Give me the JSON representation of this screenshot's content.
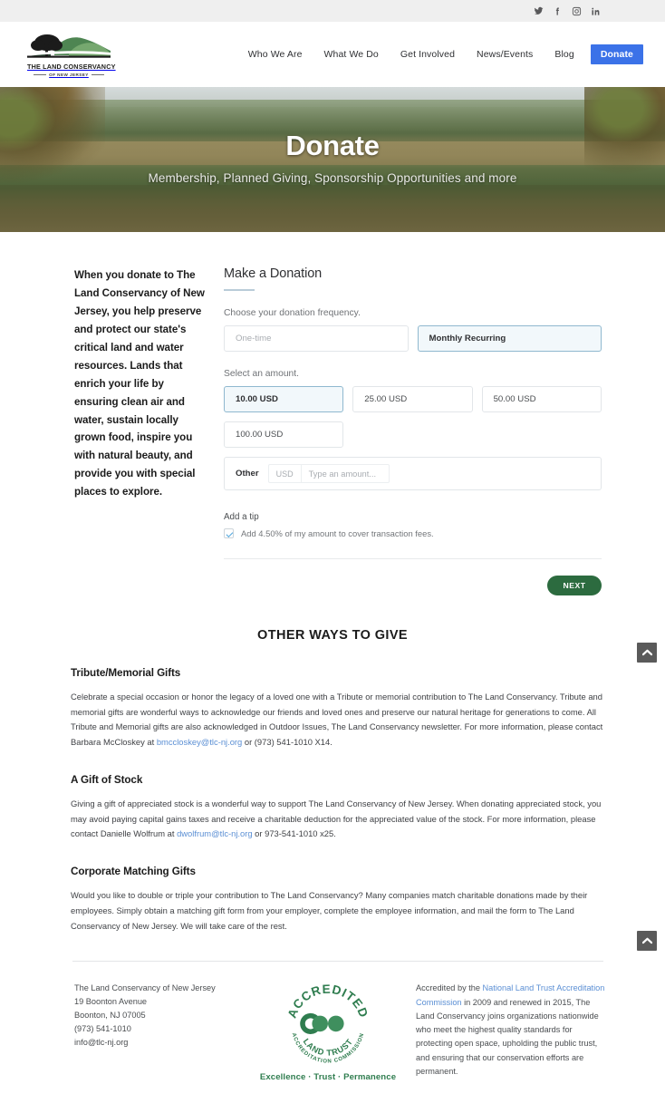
{
  "topbar": {
    "social": [
      {
        "name": "twitter-icon",
        "label": "Twitter"
      },
      {
        "name": "facebook-icon",
        "label": "Facebook"
      },
      {
        "name": "instagram-icon",
        "label": "Instagram"
      },
      {
        "name": "linkedin-icon",
        "label": "LinkedIn"
      }
    ]
  },
  "header": {
    "logo": {
      "title": "THE LAND CONSERVANCY",
      "subtitle": "OF NEW JERSEY"
    },
    "nav": [
      {
        "label": "Who We Are"
      },
      {
        "label": "What We Do"
      },
      {
        "label": "Get Involved"
      },
      {
        "label": "News/Events"
      },
      {
        "label": "Blog"
      }
    ],
    "donate_label": "Donate",
    "donate_color": "#3b72e8"
  },
  "hero": {
    "title": "Donate",
    "subtitle": "Membership, Planned Giving, Sponsorship Opportunities and more"
  },
  "intro": {
    "text": "When you donate to The Land Conservancy of New Jersey, you help preserve and protect our state's critical land and water resources. Lands that enrich your life by ensuring clean air and water, sustain locally grown food, inspire you with natural beauty, and provide you with special places to explore."
  },
  "form": {
    "title": "Make a Donation",
    "frequency_label": "Choose your donation frequency.",
    "frequency_options": [
      {
        "label": "One-time",
        "selected": false
      },
      {
        "label": "Monthly Recurring",
        "selected": true
      }
    ],
    "amount_label": "Select an amount.",
    "amount_options": [
      {
        "label": "10.00 USD",
        "selected": true
      },
      {
        "label": "25.00 USD",
        "selected": false
      },
      {
        "label": "50.00 USD",
        "selected": false
      },
      {
        "label": "100.00 USD",
        "selected": false
      }
    ],
    "other": {
      "label": "Other",
      "currency": "USD",
      "placeholder": "Type an amount...",
      "value": ""
    },
    "tip": {
      "label": "Add a tip",
      "checkbox_text": "Add 4.50% of my amount to cover transaction fees.",
      "checked": true
    },
    "next_label": "NEXT",
    "next_color": "#2c6b3f",
    "selected_color": "#8fb8cf"
  },
  "other_ways": {
    "heading": "OTHER WAYS TO GIVE",
    "sections": [
      {
        "title": "Tribute/Memorial Gifts",
        "body_before": "Celebrate a special occasion or honor the legacy of a loved one with a Tribute or memorial contribution to The Land Conservancy. Tribute and memorial gifts are wonderful ways to acknowledge our friends and loved ones and preserve our natural heritage for generations to come. All Tribute and Memorial gifts are also acknowledged in Outdoor Issues, The Land Conservancy newsletter. For more information, please contact Barbara McCloskey at ",
        "link": "bmccloskey@tlc-nj.org",
        "body_after": " or (973) 541-1010 X14."
      },
      {
        "title": "A Gift of Stock",
        "body_before": "Giving a gift of appreciated stock is a wonderful way to support The Land Conservancy of New Jersey.  When donating appreciated stock, you may avoid paying capital gains taxes and receive a charitable deduction for the appreciated value of the stock.   For more information, please contact Danielle Wolfrum at ",
        "link": "dwolfrum@tlc-nj.org",
        "body_after": " or 973-541-1010 x25."
      },
      {
        "title": "Corporate Matching Gifts",
        "body_before": "Would you like to double or triple your contribution to The Land Conservancy? Many companies match charitable donations made by their employees. Simply obtain a matching gift form from your employer, complete the employee information, and mail the form to The Land Conservancy of New Jersey. We will take care of the rest.",
        "link": "",
        "body_after": ""
      }
    ]
  },
  "footer": {
    "address": {
      "org": "The Land Conservancy of New Jersey",
      "street": "19 Boonton Avenue",
      "city": "Boonton, NJ 07005",
      "phone": "(973) 541-1010",
      "email": "info@tlc-nj.org"
    },
    "seal": {
      "top_text": "ACCREDITED",
      "bottom_text": "LAND TRUST",
      "arc_text": "ACCREDITATION COMMISSION",
      "tagline": "Excellence · Trust · Permanence",
      "color": "#2f7d4f"
    },
    "accreditation": {
      "before": "Accredited by the ",
      "link": "National Land Trust Accreditation Commission",
      "after": " in 2009 and renewed in 2015, The Land Conservancy joins organizations nationwide who meet the highest quality standards for protecting open space, upholding the public trust, and ensuring that our conservation efforts are permanent."
    }
  },
  "scroll_top": {
    "name": "scroll-to-top"
  }
}
